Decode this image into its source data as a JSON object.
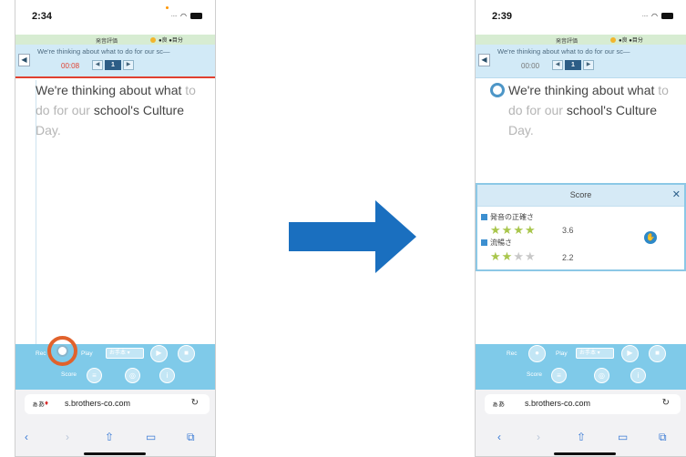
{
  "left_phone": {
    "status": {
      "time": "2:34"
    },
    "eval_bar": {
      "label": "発音評価",
      "legend": "●良 ●目分"
    },
    "header": {
      "scroll_text": "We're thinking about what to do for our sc—",
      "timer": "00:08",
      "page": "1",
      "back": "◀",
      "prev": "◀",
      "next": "▶"
    },
    "content": {
      "t1": "We're thinking about what",
      "t2": " to",
      "t3": "do for our",
      "t4": " school's Culture",
      "t5": "Day."
    },
    "toolbar": {
      "rec_label": "Rec",
      "play_label": "Play",
      "speed_select": "お手本 ▾",
      "score_label": "Score"
    },
    "browser": {
      "aa": "ぁあ",
      "url": "s.brothers-co.com",
      "reload": "↻"
    }
  },
  "right_phone": {
    "status": {
      "time": "2:39"
    },
    "eval_bar": {
      "label": "発音評価",
      "legend": "●良 ●目分"
    },
    "header": {
      "scroll_text": "We're thinking about what to do for our sc—",
      "timer": "00:00",
      "page": "1",
      "back": "◀",
      "prev": "◀",
      "next": "▶"
    },
    "content": {
      "t1": "We're thinking about what",
      "t2": " to",
      "t3": "do for our",
      "t4": " school's Culture",
      "t5": "Day."
    },
    "score_popup": {
      "title": "Score",
      "close": "✕",
      "accuracy_label": "発音の正確さ",
      "accuracy_score": "3.6",
      "accuracy_stars": 3.6,
      "fluency_label": "流暢さ",
      "fluency_score": "2.2",
      "fluency_stars": 2.2
    },
    "toolbar": {
      "rec_label": "Rec",
      "play_label": "Play",
      "speed_select": "お手本 ▾",
      "score_label": "Score"
    },
    "browser": {
      "aa": "ぁあ",
      "url": "s.brothers-co.com",
      "reload": "↻"
    }
  },
  "colors": {
    "arrow": "#1a6fbf",
    "toolbar": "#7fcae9",
    "rec_highlight": "#e1622c",
    "header": "#d2eaf7"
  }
}
